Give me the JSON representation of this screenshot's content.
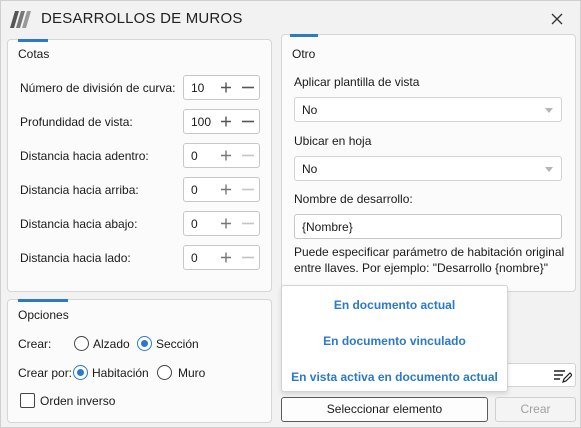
{
  "window": {
    "title": "DESARROLLOS DE MUROS"
  },
  "cotas": {
    "title": "Cotas",
    "rows": [
      {
        "label": "Número de división de curva:",
        "value": "10",
        "enabled": true
      },
      {
        "label": "Profundidad de vista:",
        "value": "100",
        "enabled": true
      },
      {
        "label": "Distancia hacia adentro:",
        "value": "0",
        "enabled": false
      },
      {
        "label": "Distancia hacia arriba:",
        "value": "0",
        "enabled": false
      },
      {
        "label": "Distancia hacia abajo:",
        "value": "0",
        "enabled": false
      },
      {
        "label": "Distancia hacia lado:",
        "value": "0",
        "enabled": false
      }
    ]
  },
  "otro": {
    "title": "Otro",
    "template_label": "Aplicar plantilla de vista",
    "template_value": "No",
    "sheet_label": "Ubicar en hoja",
    "sheet_value": "No",
    "name_label": "Nombre de desarrollo:",
    "name_value": "{Nombre}",
    "hint": "Puede especificar parámetro de habitación original entre llaves. Por ejemplo: \"Desarrollo {nombre}\""
  },
  "opciones": {
    "title": "Opciones",
    "crear_label": "Crear:",
    "crear_options": [
      "Alzado",
      "Sección"
    ],
    "crear_selected": "Sección",
    "crear_por_label": "Crear por:",
    "crear_por_options": [
      "Habitación",
      "Muro"
    ],
    "crear_por_selected": "Habitación",
    "orden_inverso_label": "Orden inverso",
    "orden_inverso_checked": false
  },
  "dropdown": {
    "items": [
      "En documento actual",
      "En documento vinculado",
      "En vista activa en documento actual"
    ]
  },
  "buttons": {
    "select_label": "Seleccionar elemento",
    "create_label": "Crear"
  },
  "colors": {
    "accent": "#2b79c9",
    "window_bg": "#f2f2f2",
    "panel_bg": "#fbfbfb"
  }
}
